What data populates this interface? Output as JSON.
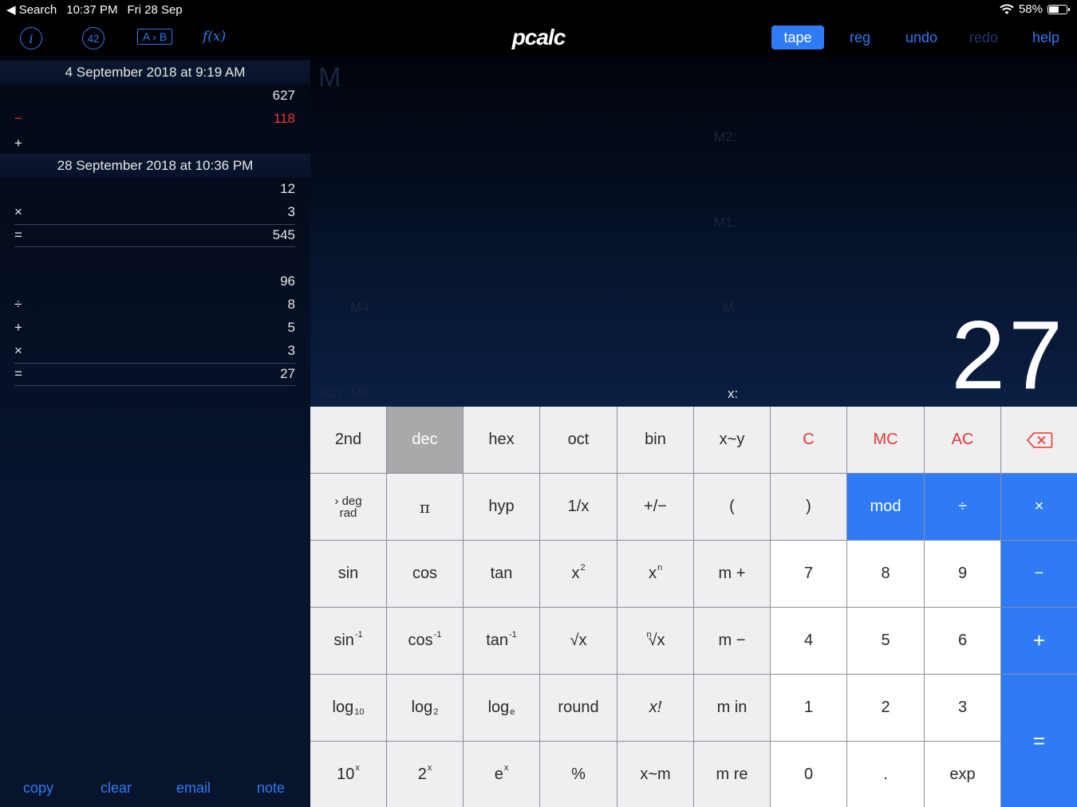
{
  "status": {
    "back": "◀ Search",
    "time": "10:37 PM",
    "date": "Fri 28 Sep",
    "battery": "58%",
    "battery_level": 0.58
  },
  "toolbar": {
    "info": "i",
    "forty_two": "42",
    "ab": "A › B",
    "fx": "f(x)",
    "logo": "pcalc",
    "tape": "tape",
    "reg": "reg",
    "undo": "undo",
    "redo": "redo",
    "help": "help"
  },
  "tape": {
    "sessions": [
      {
        "date": "4 September 2018 at 9:19 AM",
        "rows": [
          {
            "op": "",
            "value": "627"
          },
          {
            "op": "−",
            "value": "118",
            "red": true
          },
          {
            "op": "+",
            "value": ""
          }
        ]
      },
      {
        "date": "28 September 2018 at 10:36 PM",
        "rows": [
          {
            "op": "",
            "value": "12"
          },
          {
            "op": "×",
            "value": "3"
          },
          {
            "op": "=",
            "value": "545"
          },
          {
            "op": "",
            "value": "96"
          },
          {
            "op": "÷",
            "value": "8"
          },
          {
            "op": "+",
            "value": "5"
          },
          {
            "op": "×",
            "value": "3"
          },
          {
            "op": "=",
            "value": "27"
          }
        ]
      }
    ],
    "actions": {
      "copy": "copy",
      "clear": "clear",
      "email": "email",
      "note": "note"
    }
  },
  "display": {
    "memory_indicator": "M",
    "m2": "M2:",
    "m1": "M1:",
    "m4": "M4:",
    "m": "M:",
    "sci": "SCI",
    "m3": "M3:",
    "x_label": "x:",
    "value": "27"
  },
  "keys": {
    "r1": [
      "2nd",
      "dec",
      "hex",
      "oct",
      "bin",
      "x~y",
      "C",
      "MC",
      "AC"
    ],
    "deg": "deg",
    "rad": "rad",
    "pi": "π",
    "hyp": "hyp",
    "recip": "1/x",
    "plusminus": "+/−",
    "lparen": "(",
    "rparen": ")",
    "mod": "mod",
    "divide": "÷",
    "multiply": "×",
    "sin": "sin",
    "cos": "cos",
    "tan": "tan",
    "x": "x",
    "x2_sup": "2",
    "xn_sup": "n",
    "mplus": "m +",
    "n7": "7",
    "n8": "8",
    "n9": "9",
    "minus": "−",
    "inv_sup": "-1",
    "sqrt": "√x",
    "nrt_sup": "n",
    "nrt": "√x",
    "mminus": "m −",
    "n4": "4",
    "n5": "5",
    "n6": "6",
    "plus": "+",
    "log": "log",
    "sub10": "10",
    "sub2": "2",
    "sube": "e",
    "round": "round",
    "fact": "x!",
    "min": "m in",
    "n1": "1",
    "n2": "2",
    "n3": "3",
    "equals": "=",
    "ten": "10",
    "two": "2",
    "e": "e",
    "pow_sup": "x",
    "percent": "%",
    "xm": "x~m",
    "mre": "m re",
    "n0": "0",
    "dot": ".",
    "exp": "exp"
  },
  "colors": {
    "accent": "#2f7bf5",
    "red": "#e5392f",
    "key_bg": "#efeff1",
    "active_key": "#a9a9ab"
  }
}
